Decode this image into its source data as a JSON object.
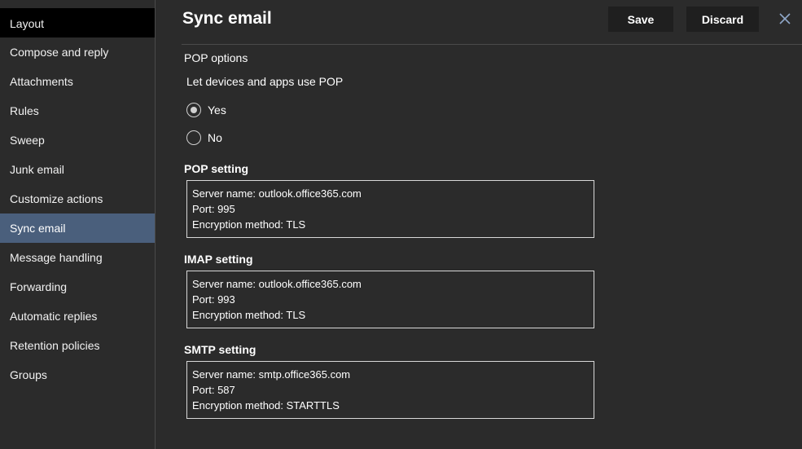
{
  "sidebar": {
    "items": [
      {
        "label": "Layout"
      },
      {
        "label": "Compose and reply"
      },
      {
        "label": "Attachments"
      },
      {
        "label": "Rules"
      },
      {
        "label": "Sweep"
      },
      {
        "label": "Junk email"
      },
      {
        "label": "Customize actions"
      },
      {
        "label": "Sync email"
      },
      {
        "label": "Message handling"
      },
      {
        "label": "Forwarding"
      },
      {
        "label": "Automatic replies"
      },
      {
        "label": "Retention policies"
      },
      {
        "label": "Groups"
      }
    ],
    "active": "Sync email"
  },
  "header": {
    "title": "Sync email",
    "save_label": "Save",
    "discard_label": "Discard"
  },
  "pop_options": {
    "section_title": "POP options",
    "question": "Let devices and apps use POP",
    "options": [
      {
        "label": "Yes",
        "selected": true
      },
      {
        "label": "No",
        "selected": false
      }
    ]
  },
  "pop_setting": {
    "title": "POP setting",
    "lines": [
      "Server name: outlook.office365.com",
      "Port: 995",
      "Encryption method: TLS"
    ]
  },
  "imap_setting": {
    "title": "IMAP setting",
    "lines": [
      "Server name: outlook.office365.com",
      "Port: 993",
      "Encryption method: TLS"
    ]
  },
  "smtp_setting": {
    "title": "SMTP setting",
    "lines": [
      "Server name: smtp.office365.com",
      "Port: 587",
      "Encryption method: STARTTLS"
    ]
  },
  "colors": {
    "background": "#2b2b2b",
    "active_item": "#4a5f7c",
    "button_bg": "#1f1f1f",
    "text": "#ffffff"
  },
  "icons": {
    "close": "close-icon"
  }
}
